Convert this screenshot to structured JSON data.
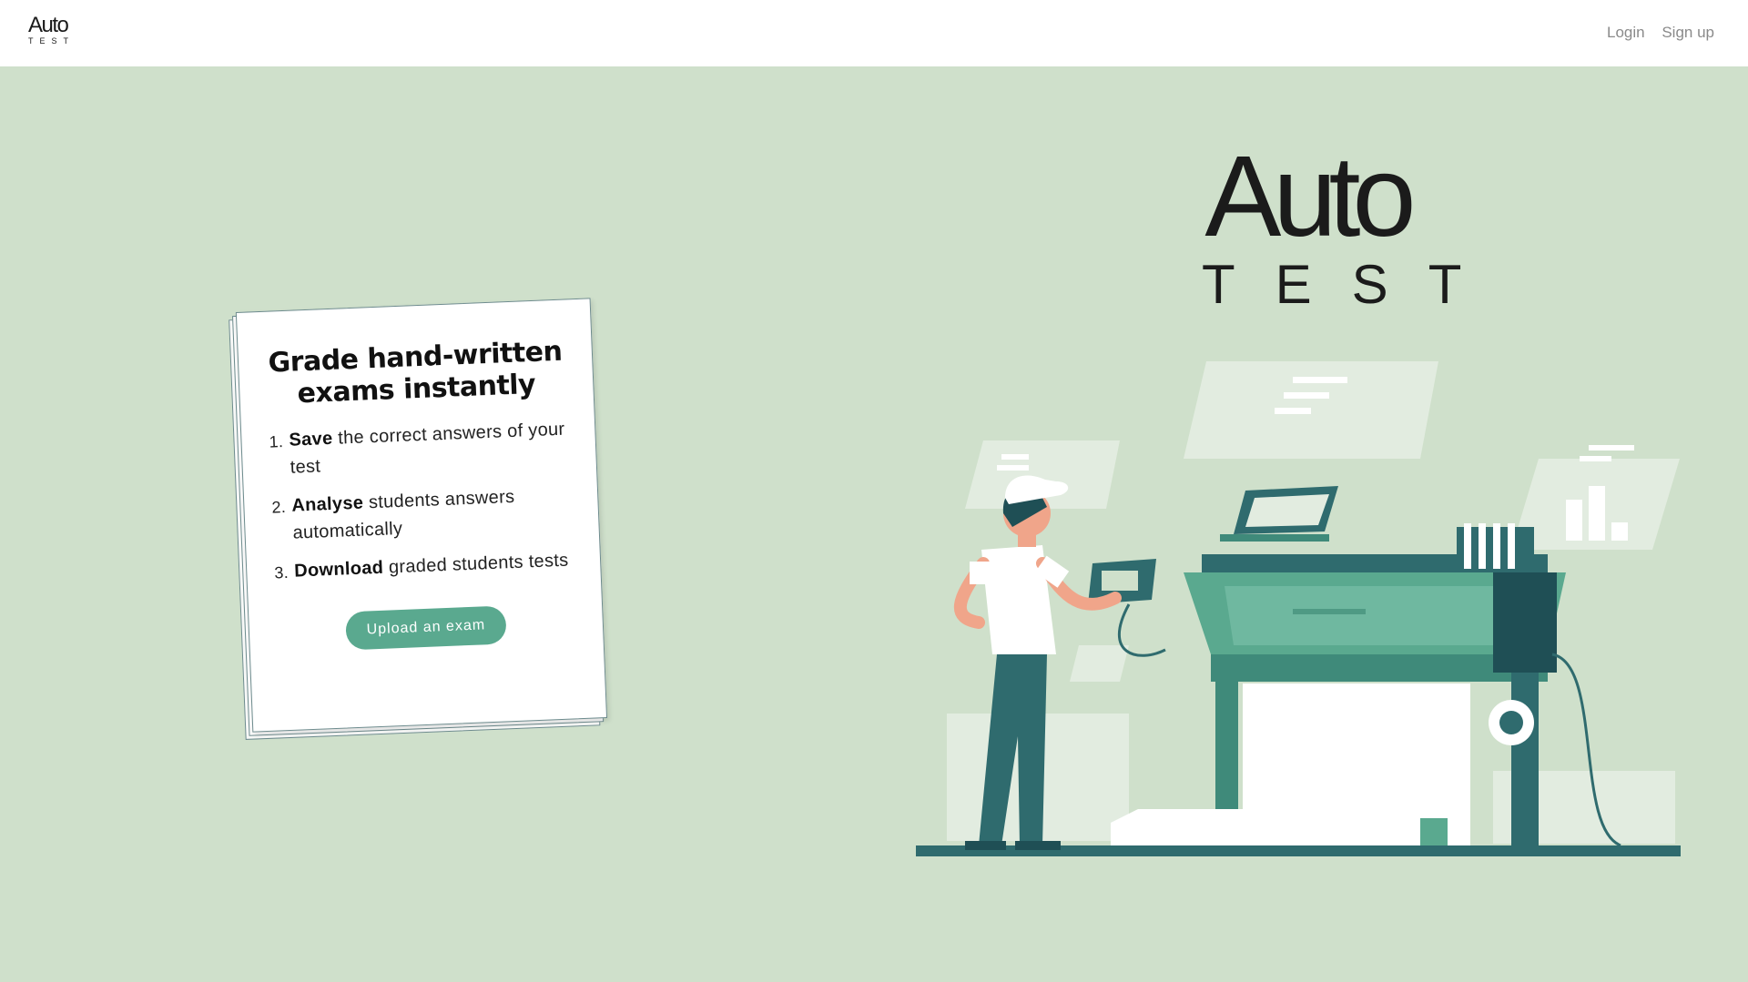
{
  "header": {
    "brand_top": "Auto",
    "brand_bottom": "TEST",
    "nav": {
      "login": "Login",
      "signup": "Sign up"
    }
  },
  "card": {
    "title": "Grade hand-written exams instantly",
    "steps": [
      {
        "num": "1.",
        "bold": "Save",
        "rest": " the correct answers of your test"
      },
      {
        "num": "2.",
        "bold": "Analyse",
        "rest": " students answers automatically"
      },
      {
        "num": "3.",
        "bold": "Download",
        "rest": " graded students tests"
      }
    ],
    "button_label": "Upload an exam"
  },
  "hero_logo": {
    "top": "Auto",
    "bottom": "TEST"
  },
  "colors": {
    "background": "#cfe0cb",
    "accent": "#5aa98f",
    "dark_teal": "#2f6b6e",
    "header_bg": "#ffffff"
  }
}
